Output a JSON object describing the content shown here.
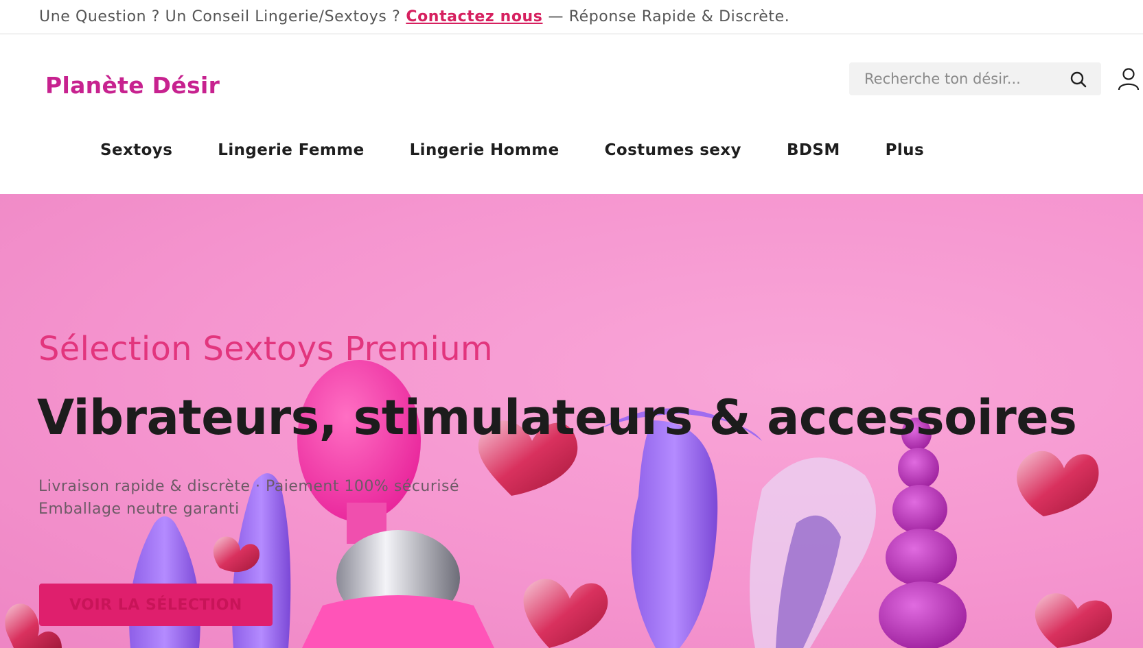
{
  "topbar": {
    "text_before": "Une Question ? Un Conseil Lingerie/Sextoys ?",
    "link_label": "Contactez nous",
    "text_after": "— Réponse Rapide & Discrète.",
    "link_color": "#d6205f"
  },
  "header": {
    "logo": "Planète Désir",
    "logo_color": "#c7228f",
    "search_placeholder": "Recherche ton désir...",
    "search_icon": "search-icon",
    "account_icon": "user-icon"
  },
  "nav": {
    "items": [
      "Sextoys",
      "Lingerie Femme",
      "Lingerie Homme",
      "Costumes sexy",
      "BDSM",
      "Plus"
    ]
  },
  "hero": {
    "subtitle": "Sélection Sextoys Premium",
    "title": "Vibrateurs, stimulateurs & accessoires",
    "desc_line1": "Livraison rapide & discrète · Paiement 100% sécurisé",
    "desc_line2": "Emballage neutre garanti",
    "button": "VOIR LA SÉLECTION",
    "background_color": "#f595cf",
    "accent_color": "#e2357d",
    "button_color": "#df1f6d"
  }
}
